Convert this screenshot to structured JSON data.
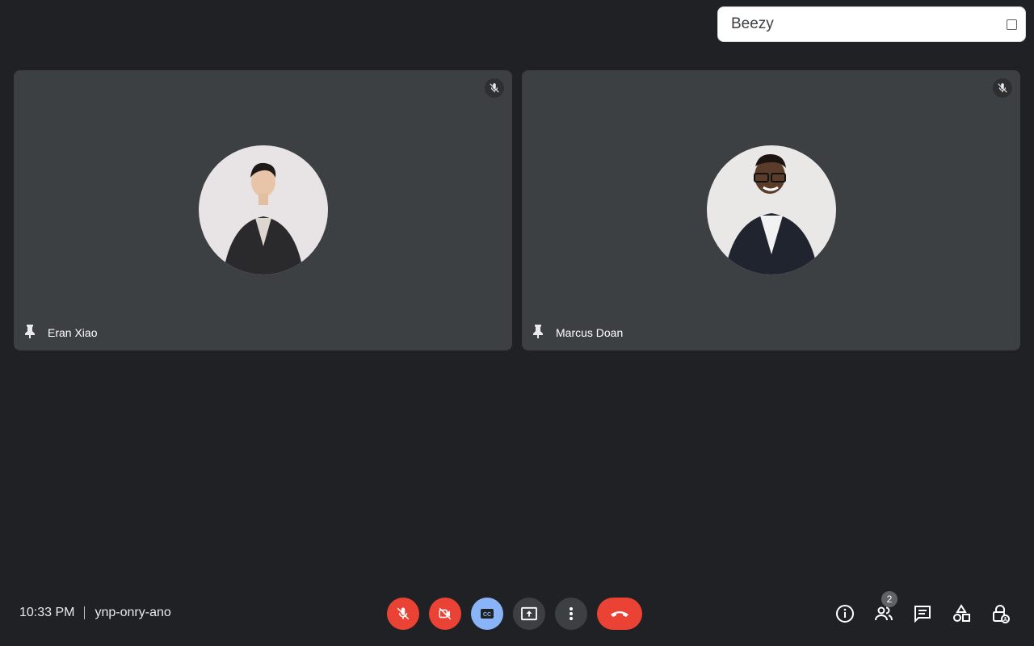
{
  "top_panel": {
    "label": "Beezy"
  },
  "tiles": [
    {
      "name": "Eran Xiao"
    },
    {
      "name": "Marcus Doan"
    }
  ],
  "meeting": {
    "time": "10:33 PM",
    "code": "ynp-onry-ano"
  },
  "participants": {
    "count": "2"
  },
  "colors": {
    "background": "#202124",
    "tile": "#3c4043",
    "danger": "#ea4335",
    "captions": "#8ab4f8"
  }
}
